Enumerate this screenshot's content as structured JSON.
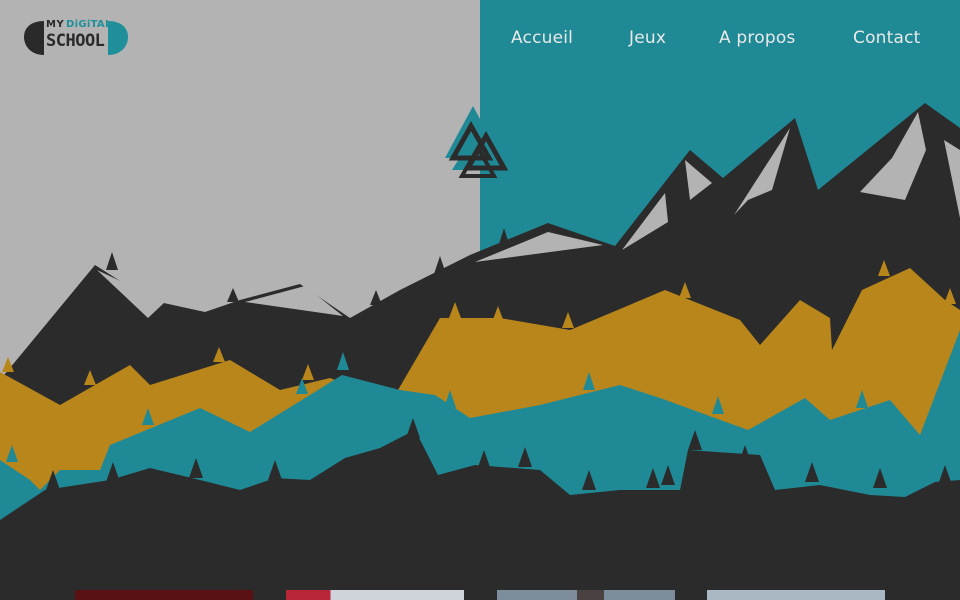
{
  "brand": {
    "logo_word_my": "MY",
    "logo_word_digital": "DiGiTAL",
    "logo_word_school": "SCHOOL"
  },
  "nav": {
    "items": [
      "Accueil",
      "Jeux",
      "A propos",
      "Contact"
    ]
  },
  "colors": {
    "left_sky": "#b3b3b3",
    "right_sky": "#1f8a96",
    "mountain_dark": "#2b2b2b",
    "mountain_snow": "#b3b3b3",
    "hill_gold": "#b8861a",
    "hill_teal": "#1f8a96"
  },
  "thumbnails": [
    {
      "name": "game-thumbnail-1"
    },
    {
      "name": "game-thumbnail-2"
    },
    {
      "name": "game-thumbnail-3"
    },
    {
      "name": "game-thumbnail-4"
    }
  ]
}
